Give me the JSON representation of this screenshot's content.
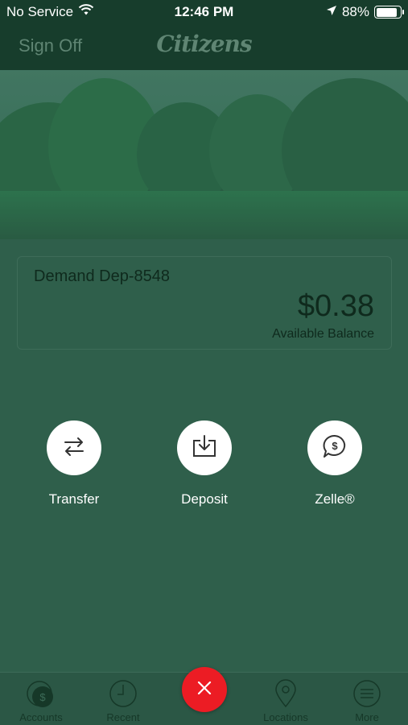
{
  "status_bar": {
    "carrier": "No Service",
    "time": "12:46 PM",
    "battery": "88%",
    "battery_level": 0.88
  },
  "nav": {
    "sign_off": "Sign Off",
    "logo": "Citizens"
  },
  "account": {
    "name": "Demand Dep-8548",
    "balance": "$0.38",
    "balance_label": "Available Balance"
  },
  "actions": [
    {
      "label": "Transfer",
      "icon": "transfer-icon"
    },
    {
      "label": "Deposit",
      "icon": "deposit-icon"
    },
    {
      "label": "Zelle®",
      "icon": "zelle-icon"
    }
  ],
  "tabs": [
    {
      "label": "Accounts",
      "icon": "accounts-icon"
    },
    {
      "label": "Recent",
      "icon": "clock-icon"
    },
    {
      "label": "Locations",
      "icon": "location-pin-icon"
    },
    {
      "label": "More",
      "icon": "menu-icon"
    }
  ],
  "colors": {
    "background": "#2f5f4b",
    "header": "#173d2c",
    "fab": "#ec1c24"
  }
}
